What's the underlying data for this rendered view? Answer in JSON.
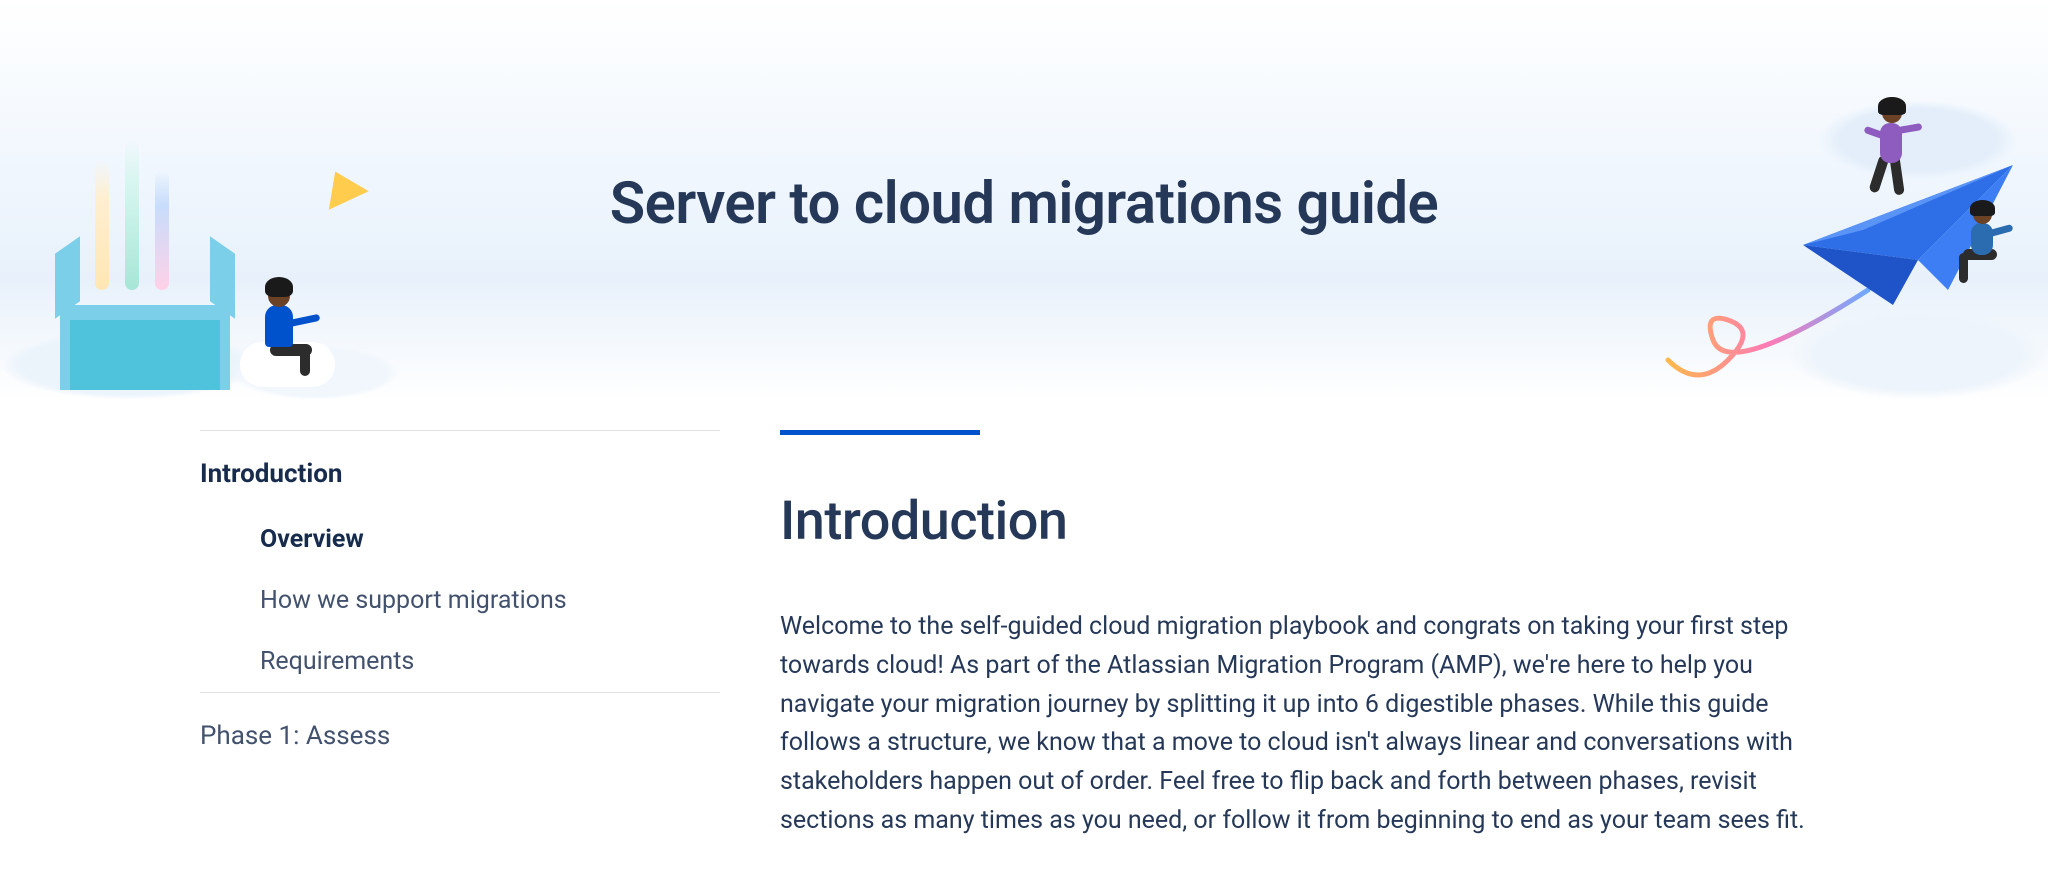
{
  "hero": {
    "title": "Server to cloud migrations guide"
  },
  "sidebar": {
    "sections": [
      {
        "title": "Introduction",
        "active": true,
        "items": [
          {
            "label": "Overview",
            "active": true
          },
          {
            "label": "How we support migrations",
            "active": false
          },
          {
            "label": "Requirements",
            "active": false
          }
        ]
      },
      {
        "title": "Phase 1: Assess",
        "active": false,
        "items": []
      }
    ]
  },
  "content": {
    "heading": "Introduction",
    "paragraph": "Welcome to the self-guided cloud migration playbook and congrats on taking your first step towards cloud! As part of the Atlassian Migration Program (AMP), we're here to help you navigate your migration journey by splitting it up into 6 digestible phases. While this guide follows a structure, we know that a move to cloud isn't always linear and conversations with stakeholders happen out of order. Feel free to flip back and forth between phases, revisit sections as many times as you need, or follow it from beginning to end as your team sees fit."
  },
  "colors": {
    "accent": "#0052CC",
    "heading": "#253858",
    "text": "#172B4D"
  }
}
